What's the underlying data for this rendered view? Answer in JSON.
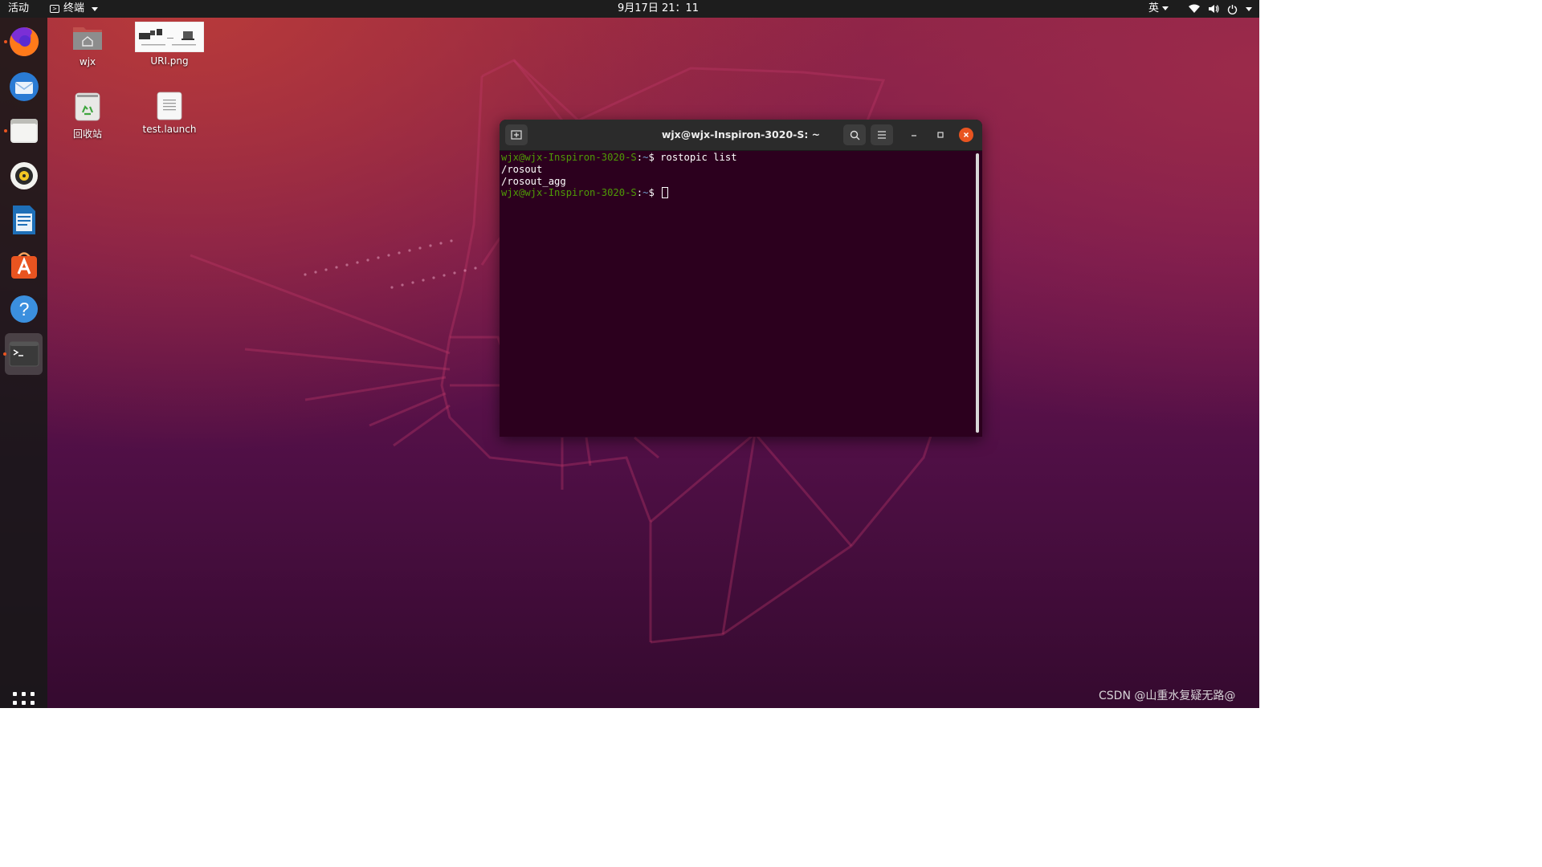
{
  "top_panel": {
    "activities": "活动",
    "app_menu": "终端",
    "clock": "9月17日  21：11",
    "input_method": "英"
  },
  "dock": {
    "items": [
      "firefox-icon",
      "thunderbird-icon",
      "files-icon",
      "rhythmbox-icon",
      "libreoffice-writer-icon",
      "software-center-icon",
      "help-icon",
      "terminal-icon"
    ],
    "show_apps": "app-grid-icon"
  },
  "desktop": {
    "icons": [
      {
        "label": "wjx",
        "icon": "home-folder-icon"
      },
      {
        "label": "URI.png",
        "icon": "image-thumbnail-icon"
      },
      {
        "label": "回收站",
        "icon": "trash-icon"
      },
      {
        "label": "test.launch",
        "icon": "text-file-icon"
      }
    ]
  },
  "terminal": {
    "title": "wjx@wjx-Inspiron-3020-S: ~",
    "prompt_user": "wjx@wjx-Inspiron-3020-S",
    "prompt_sep": ":",
    "prompt_path": "~",
    "prompt_end": "$ ",
    "command": "rostopic list",
    "output": [
      "/rosout",
      "/rosout_agg"
    ]
  },
  "watermark": "CSDN @山重水复疑无路@",
  "colors": {
    "accent": "#e95420",
    "prompt_user": "#4e9a06",
    "prompt_path": "#729fcf",
    "terminal_bg": "#2c001e"
  }
}
